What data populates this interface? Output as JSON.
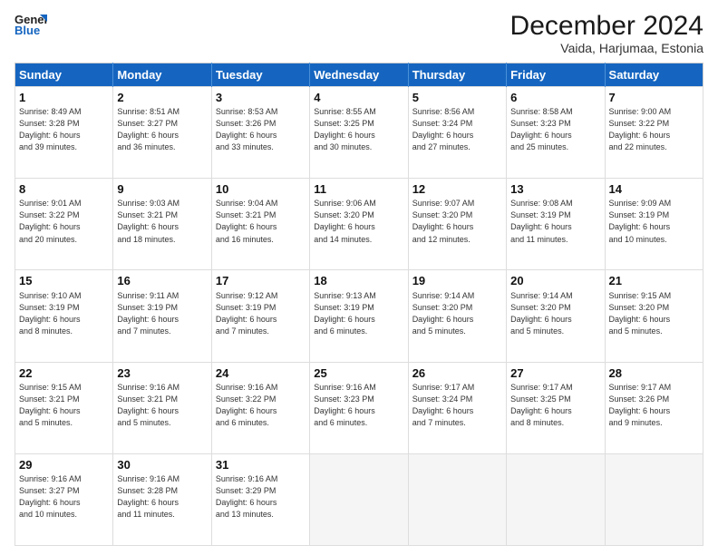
{
  "header": {
    "logo_line1": "General",
    "logo_line2": "Blue",
    "title": "December 2024",
    "subtitle": "Vaida, Harjumaa, Estonia"
  },
  "days_of_week": [
    "Sunday",
    "Monday",
    "Tuesday",
    "Wednesday",
    "Thursday",
    "Friday",
    "Saturday"
  ],
  "weeks": [
    [
      {
        "day": "1",
        "info": "Sunrise: 8:49 AM\nSunset: 3:28 PM\nDaylight: 6 hours\nand 39 minutes."
      },
      {
        "day": "2",
        "info": "Sunrise: 8:51 AM\nSunset: 3:27 PM\nDaylight: 6 hours\nand 36 minutes."
      },
      {
        "day": "3",
        "info": "Sunrise: 8:53 AM\nSunset: 3:26 PM\nDaylight: 6 hours\nand 33 minutes."
      },
      {
        "day": "4",
        "info": "Sunrise: 8:55 AM\nSunset: 3:25 PM\nDaylight: 6 hours\nand 30 minutes."
      },
      {
        "day": "5",
        "info": "Sunrise: 8:56 AM\nSunset: 3:24 PM\nDaylight: 6 hours\nand 27 minutes."
      },
      {
        "day": "6",
        "info": "Sunrise: 8:58 AM\nSunset: 3:23 PM\nDaylight: 6 hours\nand 25 minutes."
      },
      {
        "day": "7",
        "info": "Sunrise: 9:00 AM\nSunset: 3:22 PM\nDaylight: 6 hours\nand 22 minutes."
      }
    ],
    [
      {
        "day": "8",
        "info": "Sunrise: 9:01 AM\nSunset: 3:22 PM\nDaylight: 6 hours\nand 20 minutes."
      },
      {
        "day": "9",
        "info": "Sunrise: 9:03 AM\nSunset: 3:21 PM\nDaylight: 6 hours\nand 18 minutes."
      },
      {
        "day": "10",
        "info": "Sunrise: 9:04 AM\nSunset: 3:21 PM\nDaylight: 6 hours\nand 16 minutes."
      },
      {
        "day": "11",
        "info": "Sunrise: 9:06 AM\nSunset: 3:20 PM\nDaylight: 6 hours\nand 14 minutes."
      },
      {
        "day": "12",
        "info": "Sunrise: 9:07 AM\nSunset: 3:20 PM\nDaylight: 6 hours\nand 12 minutes."
      },
      {
        "day": "13",
        "info": "Sunrise: 9:08 AM\nSunset: 3:19 PM\nDaylight: 6 hours\nand 11 minutes."
      },
      {
        "day": "14",
        "info": "Sunrise: 9:09 AM\nSunset: 3:19 PM\nDaylight: 6 hours\nand 10 minutes."
      }
    ],
    [
      {
        "day": "15",
        "info": "Sunrise: 9:10 AM\nSunset: 3:19 PM\nDaylight: 6 hours\nand 8 minutes."
      },
      {
        "day": "16",
        "info": "Sunrise: 9:11 AM\nSunset: 3:19 PM\nDaylight: 6 hours\nand 7 minutes."
      },
      {
        "day": "17",
        "info": "Sunrise: 9:12 AM\nSunset: 3:19 PM\nDaylight: 6 hours\nand 7 minutes."
      },
      {
        "day": "18",
        "info": "Sunrise: 9:13 AM\nSunset: 3:19 PM\nDaylight: 6 hours\nand 6 minutes."
      },
      {
        "day": "19",
        "info": "Sunrise: 9:14 AM\nSunset: 3:20 PM\nDaylight: 6 hours\nand 5 minutes."
      },
      {
        "day": "20",
        "info": "Sunrise: 9:14 AM\nSunset: 3:20 PM\nDaylight: 6 hours\nand 5 minutes."
      },
      {
        "day": "21",
        "info": "Sunrise: 9:15 AM\nSunset: 3:20 PM\nDaylight: 6 hours\nand 5 minutes."
      }
    ],
    [
      {
        "day": "22",
        "info": "Sunrise: 9:15 AM\nSunset: 3:21 PM\nDaylight: 6 hours\nand 5 minutes."
      },
      {
        "day": "23",
        "info": "Sunrise: 9:16 AM\nSunset: 3:21 PM\nDaylight: 6 hours\nand 5 minutes."
      },
      {
        "day": "24",
        "info": "Sunrise: 9:16 AM\nSunset: 3:22 PM\nDaylight: 6 hours\nand 6 minutes."
      },
      {
        "day": "25",
        "info": "Sunrise: 9:16 AM\nSunset: 3:23 PM\nDaylight: 6 hours\nand 6 minutes."
      },
      {
        "day": "26",
        "info": "Sunrise: 9:17 AM\nSunset: 3:24 PM\nDaylight: 6 hours\nand 7 minutes."
      },
      {
        "day": "27",
        "info": "Sunrise: 9:17 AM\nSunset: 3:25 PM\nDaylight: 6 hours\nand 8 minutes."
      },
      {
        "day": "28",
        "info": "Sunrise: 9:17 AM\nSunset: 3:26 PM\nDaylight: 6 hours\nand 9 minutes."
      }
    ],
    [
      {
        "day": "29",
        "info": "Sunrise: 9:16 AM\nSunset: 3:27 PM\nDaylight: 6 hours\nand 10 minutes."
      },
      {
        "day": "30",
        "info": "Sunrise: 9:16 AM\nSunset: 3:28 PM\nDaylight: 6 hours\nand 11 minutes."
      },
      {
        "day": "31",
        "info": "Sunrise: 9:16 AM\nSunset: 3:29 PM\nDaylight: 6 hours\nand 13 minutes."
      },
      null,
      null,
      null,
      null
    ]
  ]
}
